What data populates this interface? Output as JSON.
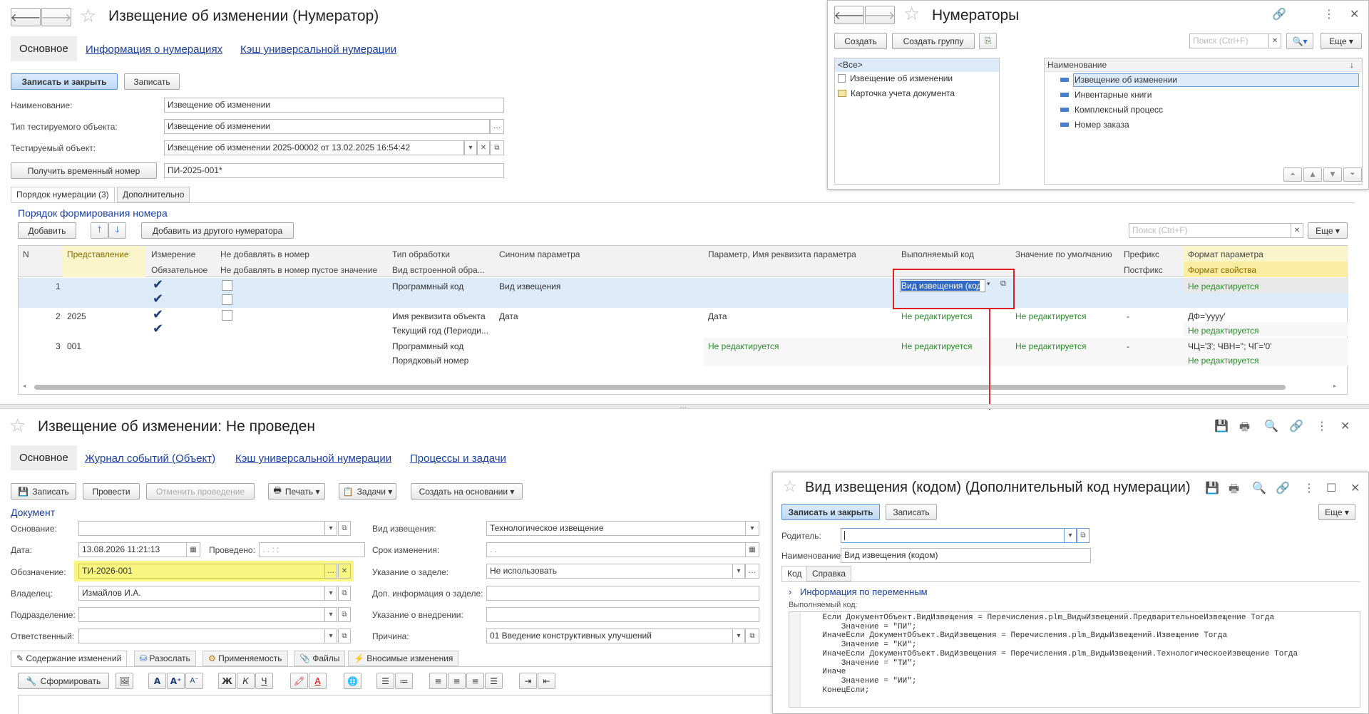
{
  "top": {
    "title": "Извещение об изменении (Нумератор)",
    "tabs": {
      "main": "Основное",
      "info": "Информация о нумерациях",
      "cache": "Кэш универсальной нумерации"
    },
    "save_close": "Записать и закрыть",
    "save": "Записать",
    "labels": {
      "name": "Наименование:",
      "type": "Тип тестируемого объекта:",
      "object": "Тестируемый объект:"
    },
    "values": {
      "name": "Извещение об изменении",
      "type": "Извещение об изменении",
      "object": "Извещение об изменении 2025-00002 от 13.02.2025 16:54:42",
      "temp": "ПИ-2025-001*"
    },
    "get_temp": "Получить временный номер",
    "subtabs": {
      "order": "Порядок нумерации (3)",
      "extra": "Дополнительно"
    },
    "section": "Порядок формирования номера",
    "add": "Добавить",
    "add_other": "Добавить из другого нумератора",
    "search_placeholder": "Поиск (Ctrl+F)",
    "more": "Еще",
    "headers": {
      "n": "N",
      "repr": "Представление",
      "dim": "Измерение",
      "not_add": "Не добавлять в номер",
      "proc": "Тип обработки",
      "syn": "Синоним параметра",
      "param": "Параметр, Имя реквизита параметра",
      "code": "Выполняемый код",
      "def": "Значение по умолчанию",
      "prefix": "Префикс",
      "format": "Формат параметра",
      "required": "Обязательное",
      "not_add_empty": "Не добавлять в номер пустое значение",
      "builtin": "Вид встроенной обра...",
      "postfix": "Постфикс",
      "prop_format": "Формат свойства"
    },
    "rows": [
      {
        "n": "1",
        "repr": "",
        "proc": "Программный код",
        "syn": "Вид извещения",
        "code": "Вид извещения (код",
        "format": "Не редактируется"
      },
      {
        "n": "2",
        "repr": "2025",
        "proc": "Имя реквизита объекта",
        "proc2": "Текущий год (Периоди...",
        "syn": "Дата",
        "param": "Дата",
        "code": "Не редактируется",
        "def": "Не редактируется",
        "prefix": "-",
        "format": "ДФ='yyyy'",
        "format2": "Не редактируется"
      },
      {
        "n": "3",
        "repr": "001",
        "proc": "Программный код",
        "proc2": "Порядковый номер",
        "param": "Не редактируется",
        "code": "Не редактируется",
        "def": "Не редактируется",
        "prefix": "-",
        "format": "ЧЦ='3'; ЧВН=''; ЧГ='0'",
        "format2": "Не редактируется"
      }
    ]
  },
  "numerators": {
    "title": "Нумераторы",
    "create": "Создать",
    "create_group": "Создать группу",
    "search_placeholder": "Поиск (Ctrl+F)",
    "more": "Еще",
    "left": [
      "<Все>",
      "Извещение об изменении",
      "Карточка учета документа"
    ],
    "col": "Наименование",
    "right": [
      "Извещение об изменении",
      "Инвентарные книги",
      "Комплексный процесс",
      "Номер заказа"
    ]
  },
  "doc": {
    "title": "Извещение об изменении: Не проведен",
    "tabs": {
      "main": "Основное",
      "journal": "Журнал событий (Объект)",
      "cache": "Кэш универсальной нумерации",
      "proc": "Процессы и задачи"
    },
    "buttons": {
      "save": "Записать",
      "post": "Провести",
      "cancel": "Отменить проведение",
      "print": "Печать",
      "tasks": "Задачи",
      "create": "Создать на основании"
    },
    "section": "Документ",
    "labels": {
      "basis": "Основание:",
      "date": "Дата:",
      "posted": "Проведено:",
      "code": "Обозначение:",
      "owner": "Владелец:",
      "dept": "Подразделение:",
      "resp": "Ответственный:",
      "kind": "Вид извещения:",
      "term": "Срок изменения:",
      "backlog": "Указание о заделе:",
      "backlog_info": "Доп. информация о заделе:",
      "impl": "Указание о внедрении:",
      "reason": "Причина:"
    },
    "values": {
      "date": "13.08.2026 11:21:13",
      "posted": " .  .     :  :",
      "code": "ТИ-2026-001",
      "owner": "Измайлов И.А.",
      "kind": "Технологическое извещение",
      "term": " .  .",
      "backlog": "Не использовать",
      "reason": "01 Введение конструктивных улучшений"
    },
    "bottom_tabs": [
      "Содержание изменений",
      "Разослать",
      "Применяемость",
      "Файлы",
      "Вносимые изменения"
    ],
    "form": "Сформировать"
  },
  "code_win": {
    "title": "Вид извещения (кодом) (Дополнительный код нумерации)",
    "save_close": "Записать и закрыть",
    "save": "Записать",
    "more": "Еще",
    "labels": {
      "parent": "Родитель:",
      "name": "Наименование:",
      "code": "Выполняемый код:"
    },
    "name_value": "Вид извещения (кодом)",
    "tabs": {
      "code": "Код",
      "help": "Справка"
    },
    "vars": "Информация по переменным",
    "code_lines": [
      "    Если ДокументОбъект.ВидИзвещения = Перечисления.plm_ВидыИзвещений.ПредварительноеИзвещение Тогда",
      "        Значение = \"ПИ\";",
      "    ИначеЕсли ДокументОбъект.ВидИзвещения = Перечисления.plm_ВидыИзвещений.Извещение Тогда",
      "        Значение = \"КИ\";",
      "    ИначеЕсли ДокументОбъект.ВидИзвещения = Перечисления.plm_ВидыИзвещений.ТехнологическоеИзвещение Тогда",
      "        Значение = \"ТИ\";",
      "    Иначе",
      "        Значение = \"ИИ\";",
      "    КонецЕсли;"
    ]
  }
}
